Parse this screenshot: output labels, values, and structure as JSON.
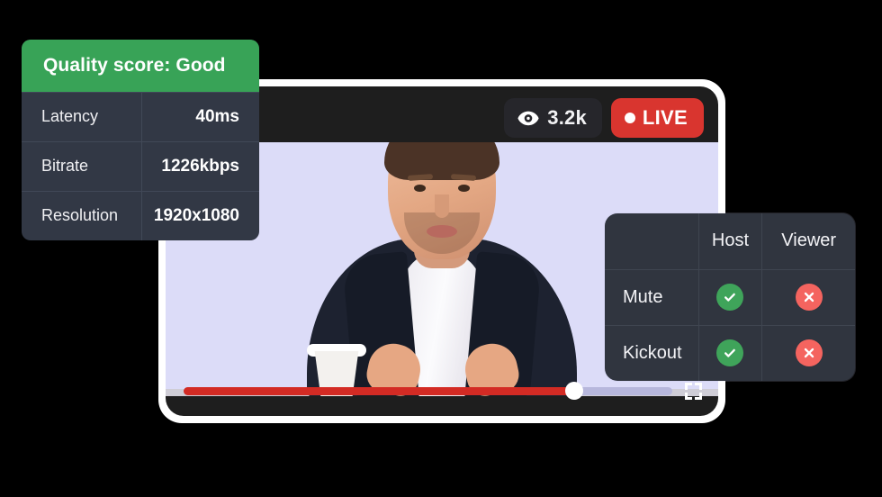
{
  "page": {
    "background_color": "#000000"
  },
  "player": {
    "frame_color": "#1e1e1e",
    "border_color": "#ffffff",
    "video_background": "#dcdcf8",
    "viewer_badge": {
      "icon": "eye-icon",
      "count": "3.2k",
      "background_color": "#26262b"
    },
    "live_badge": {
      "label": "LIVE",
      "dot": "live-dot-icon",
      "background_color": "#d9352f"
    },
    "controls": {
      "progress_percent": 80,
      "progress_fill_color": "#d32b24",
      "progress_track_color": "#b7b7dc",
      "thumb_color": "#ffffff",
      "fullscreen_icon": "fullscreen-icon"
    }
  },
  "stats_card": {
    "header": "Quality score: Good",
    "header_color": "#38a357",
    "background_color": "#323845",
    "rows": [
      {
        "label": "Latency",
        "value": "40ms"
      },
      {
        "label": "Bitrate",
        "value": "1226kbps"
      },
      {
        "label": "Resolution",
        "value": "1920x1080"
      }
    ]
  },
  "permissions_card": {
    "background_color": "#30353f",
    "columns": [
      "",
      "Host",
      "Viewer"
    ],
    "rows": [
      {
        "action": "Mute",
        "host": "allowed",
        "viewer": "denied"
      },
      {
        "action": "Kickout",
        "host": "allowed",
        "viewer": "denied"
      }
    ],
    "allowed_color": "#3fa45a",
    "denied_color": "#f4645f",
    "allowed_icon": "check-circle-icon",
    "denied_icon": "x-circle-icon"
  }
}
